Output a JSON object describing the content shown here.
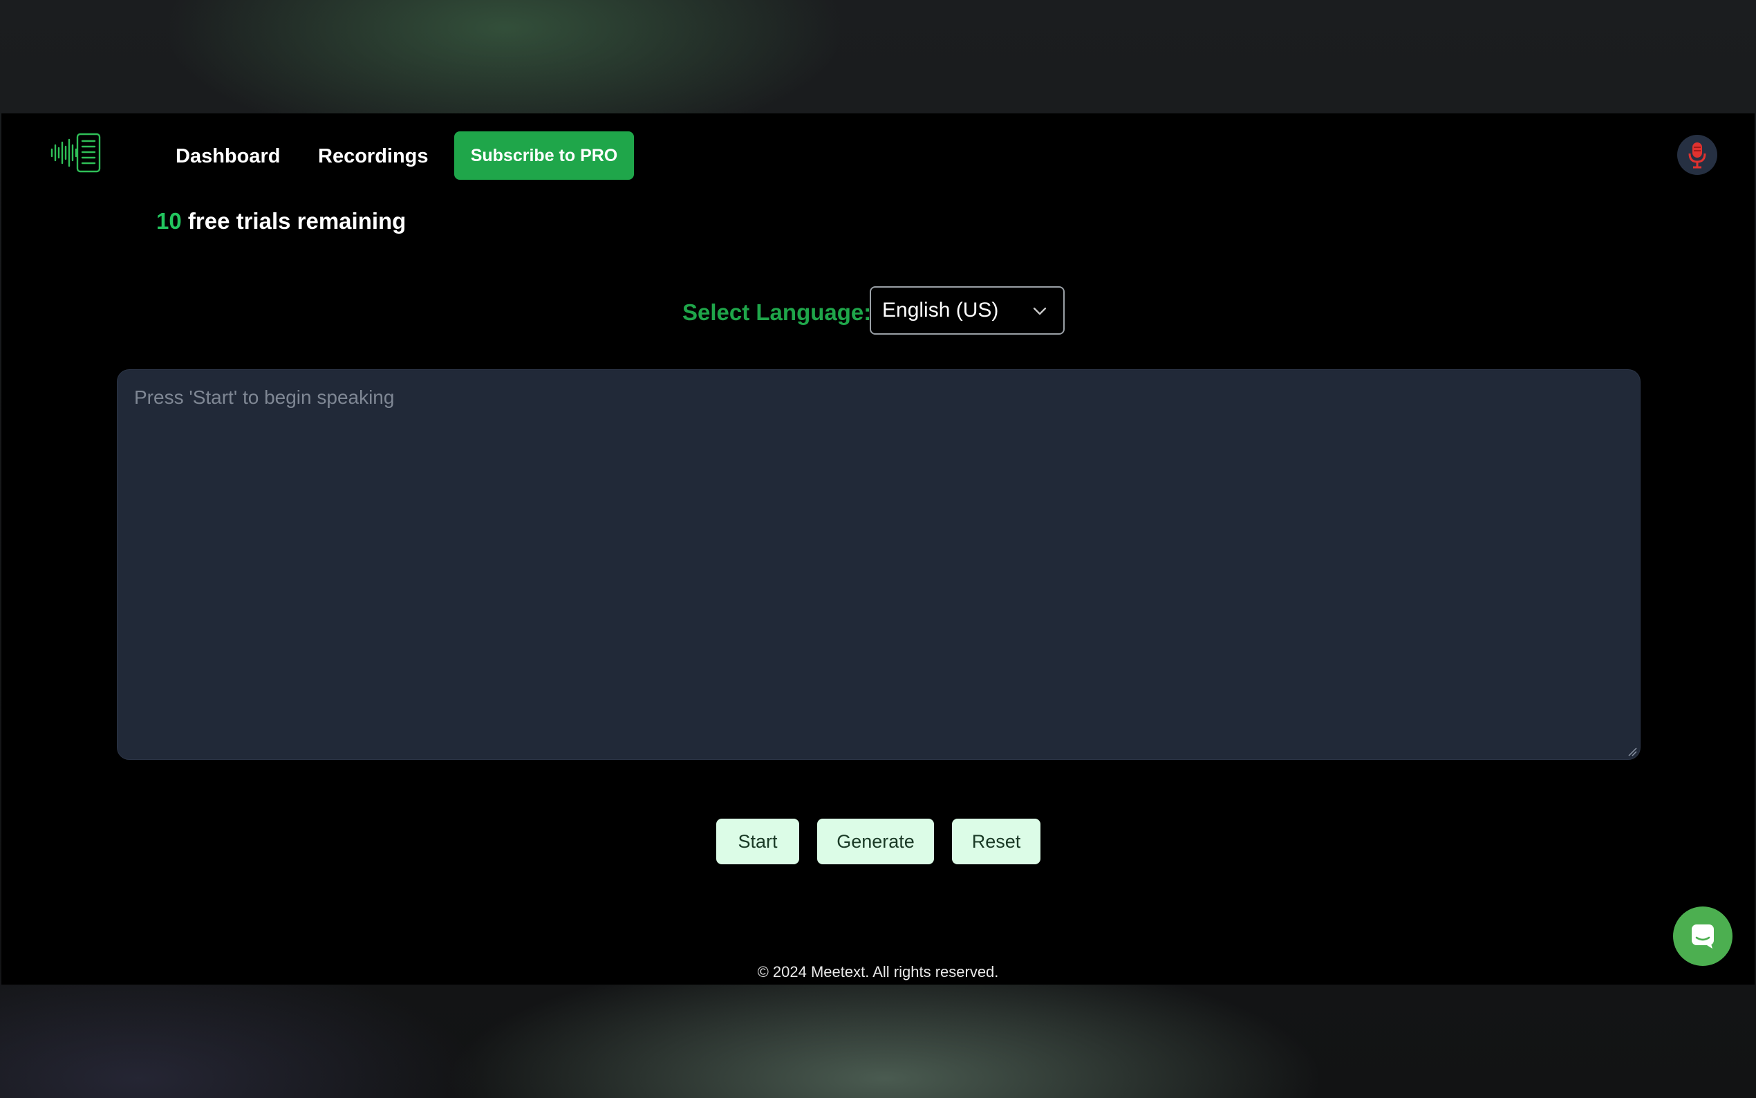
{
  "header": {
    "logo_icon": "waveform-document-icon",
    "nav": {
      "dashboard_label": "Dashboard",
      "recordings_label": "Recordings"
    },
    "subscribe_label": "Subscribe to PRO",
    "avatar_icon": "microphone-icon"
  },
  "trials": {
    "count": "10",
    "text": " free trials remaining"
  },
  "language": {
    "label": "Select Language:",
    "selected": "English (US)"
  },
  "transcript": {
    "placeholder": "Press 'Start' to begin speaking",
    "value": ""
  },
  "actions": {
    "start_label": "Start",
    "generate_label": "Generate",
    "reset_label": "Reset"
  },
  "chat": {
    "icon": "chat-bubble-icon"
  },
  "footer": {
    "copyright": "© 2024 Meetext. All rights reserved."
  },
  "colors": {
    "accent": "#1fa64a",
    "accent_text": "#22c55e",
    "button_bg": "#dcfce7",
    "panel_bg": "#212938",
    "chat_bg": "#4caf50"
  }
}
